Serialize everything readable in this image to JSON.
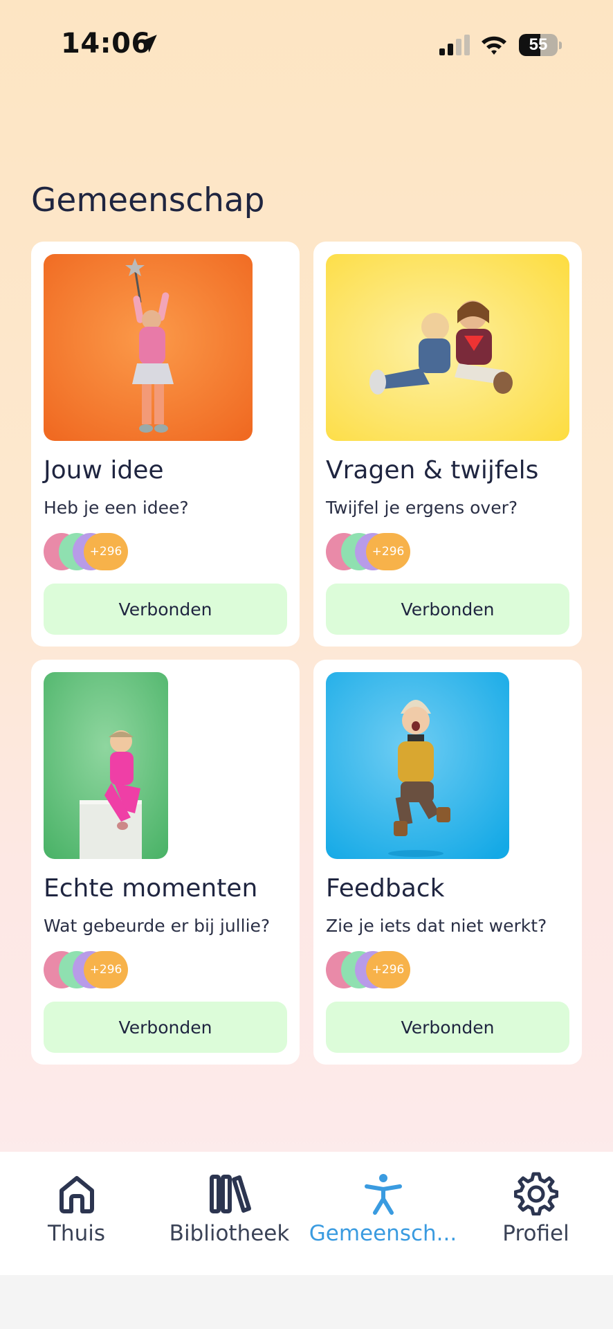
{
  "status_bar": {
    "time": "14:06",
    "battery": "55",
    "battery_level": 0.55
  },
  "page": {
    "title": "Gemeenschap"
  },
  "cards": [
    {
      "title": "Jouw idee",
      "subtitle": "Heb je een idee?",
      "member_count": "+296",
      "button": "Verbonden",
      "photo_color": "#f57a33"
    },
    {
      "title": "Vragen & twijfels",
      "subtitle": "Twijfel je ergens over?",
      "member_count": "+296",
      "button": "Verbonden",
      "photo_color": "#fde060"
    },
    {
      "title": "Echte momenten",
      "subtitle": "Wat gebeurde er bij jullie?",
      "member_count": "+296",
      "button": "Verbonden",
      "photo_color": "#5cc27a"
    },
    {
      "title": "Feedback",
      "subtitle": "Zie je iets dat niet werkt?",
      "member_count": "+296",
      "button": "Verbonden",
      "photo_color": "#27aee8"
    }
  ],
  "tabbar": {
    "items": [
      {
        "label": "Thuis",
        "icon": "home-icon"
      },
      {
        "label": "Bibliotheek",
        "icon": "library-icon"
      },
      {
        "label": "Gemeensch...",
        "icon": "community-icon",
        "active": true
      },
      {
        "label": "Profiel",
        "icon": "gear-icon"
      }
    ],
    "active_color": "#3a9be0"
  }
}
